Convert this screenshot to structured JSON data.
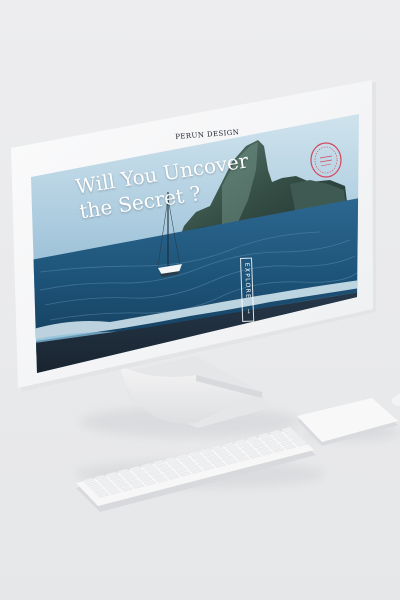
{
  "website": {
    "brand": "PERUN DESIGN",
    "headline_line1": "Will You Uncover",
    "headline_line2": "the Secret ?",
    "explore_label": "EXPLORE",
    "explore_arrow": "→",
    "badge_icon": "circular-stamp-badge"
  },
  "colors": {
    "background": "#e9eaec",
    "device": "#f7f7f8",
    "sky": "#9dc3d8",
    "sea": "#1b4f74",
    "sand": "#1c2935",
    "badge": "#d4465c"
  }
}
